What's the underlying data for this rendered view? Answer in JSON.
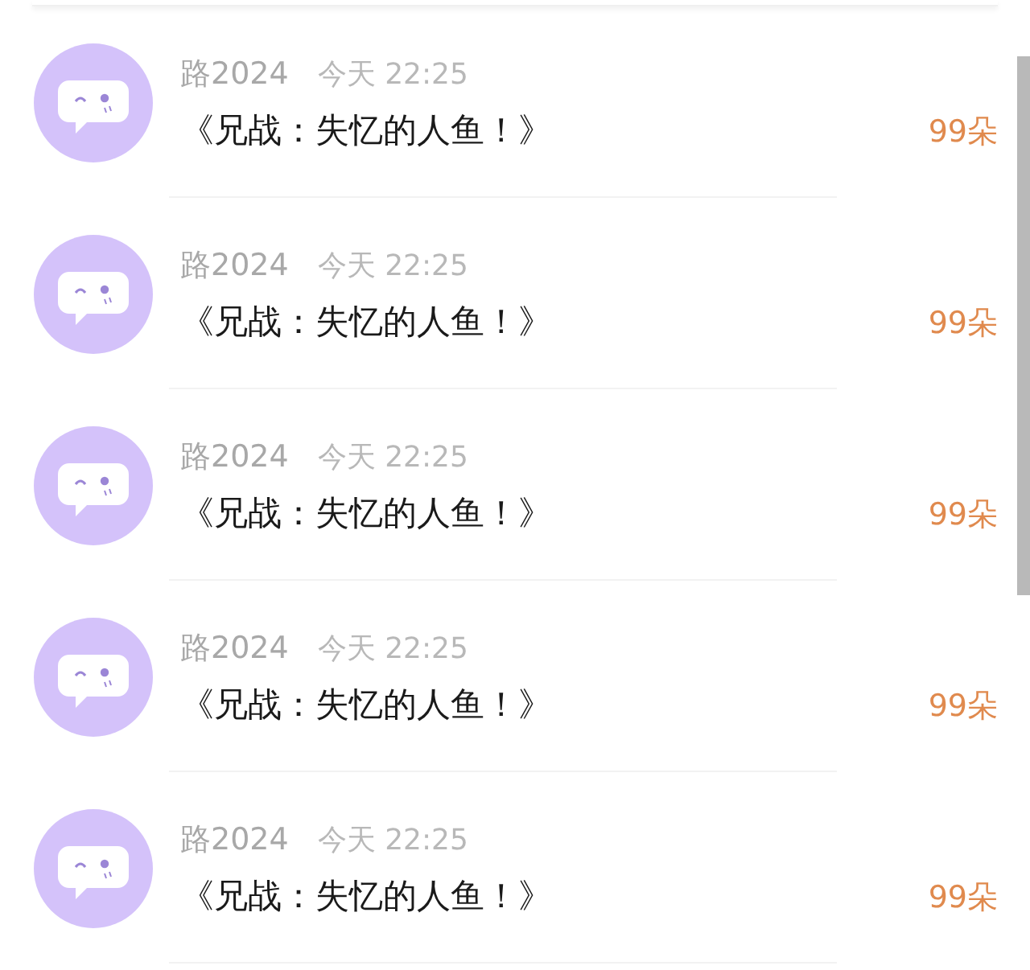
{
  "items": [
    {
      "user": "路2024",
      "time": "今天 22:25",
      "title": "《兄战：失忆的人鱼！》",
      "amount": "99朵"
    },
    {
      "user": "路2024",
      "time": "今天 22:25",
      "title": "《兄战：失忆的人鱼！》",
      "amount": "99朵"
    },
    {
      "user": "路2024",
      "time": "今天 22:25",
      "title": "《兄战：失忆的人鱼！》",
      "amount": "99朵"
    },
    {
      "user": "路2024",
      "time": "今天 22:25",
      "title": "《兄战：失忆的人鱼！》",
      "amount": "99朵"
    },
    {
      "user": "路2024",
      "time": "今天 22:25",
      "title": "《兄战：失忆的人鱼！》",
      "amount": "99朵"
    }
  ]
}
